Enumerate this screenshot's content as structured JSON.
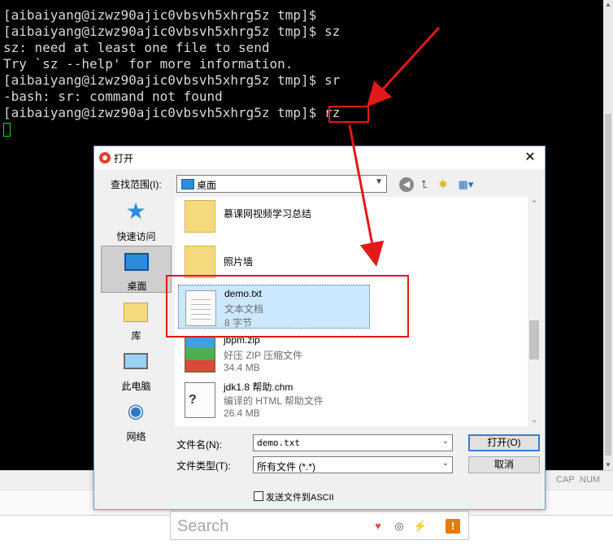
{
  "terminal": {
    "lines": [
      "[aibaiyang@izwz90ajic0vbsvh5xhrg5z tmp]$",
      "[aibaiyang@izwz90ajic0vbsvh5xhrg5z tmp]$ sz",
      "sz: need at least one file to send",
      "Try `sz --help' for more information.",
      "[aibaiyang@izwz90ajic0vbsvh5xhrg5z tmp]$ sr",
      "-bash: sr: command not found",
      "[aibaiyang@izwz90ajic0vbsvh5xhrg5z tmp]$ rz"
    ]
  },
  "statusbar": {
    "cap": "CAP",
    "num": "NUM"
  },
  "search": {
    "placeholder": "Search"
  },
  "dialog": {
    "title": "打开",
    "look_in_label": "查找范围(I):",
    "look_in_value": "桌面",
    "places": [
      {
        "label": "快速访问",
        "icon": "star-icon"
      },
      {
        "label": "桌面",
        "icon": "desktop-icon"
      },
      {
        "label": "库",
        "icon": "library-icon"
      },
      {
        "label": "此电脑",
        "icon": "computer-icon"
      },
      {
        "label": "网络",
        "icon": "network-icon"
      }
    ],
    "files": [
      {
        "name": "慕课网视频学习总结",
        "type": "",
        "size": "",
        "icon": "folder-icon"
      },
      {
        "name": "照片墙",
        "type": "",
        "size": "",
        "icon": "folder-icon"
      },
      {
        "name": "demo.txt",
        "type": "文本文档",
        "size": "8 字节",
        "icon": "text-file-icon"
      },
      {
        "name": "jbpm.zip",
        "type": "好压 ZIP 压缩文件",
        "size": "34.4 MB",
        "icon": "archive-icon"
      },
      {
        "name": "jdk1.8 帮助.chm",
        "type": "编译的 HTML 帮助文件",
        "size": "26.4 MB",
        "icon": "chm-icon"
      }
    ],
    "filename_label": "文件名(N):",
    "filename_value": "demo.txt",
    "filetype_label": "文件类型(T):",
    "filetype_value": "所有文件 (*.*)",
    "open_button": "打开(O)",
    "cancel_button": "取消",
    "ascii_checkbox": "发送文件到ASCII"
  },
  "colors": {
    "annotation_red": "#e31818",
    "terminal_bg": "#000000",
    "selection_blue": "#cce8ff"
  }
}
